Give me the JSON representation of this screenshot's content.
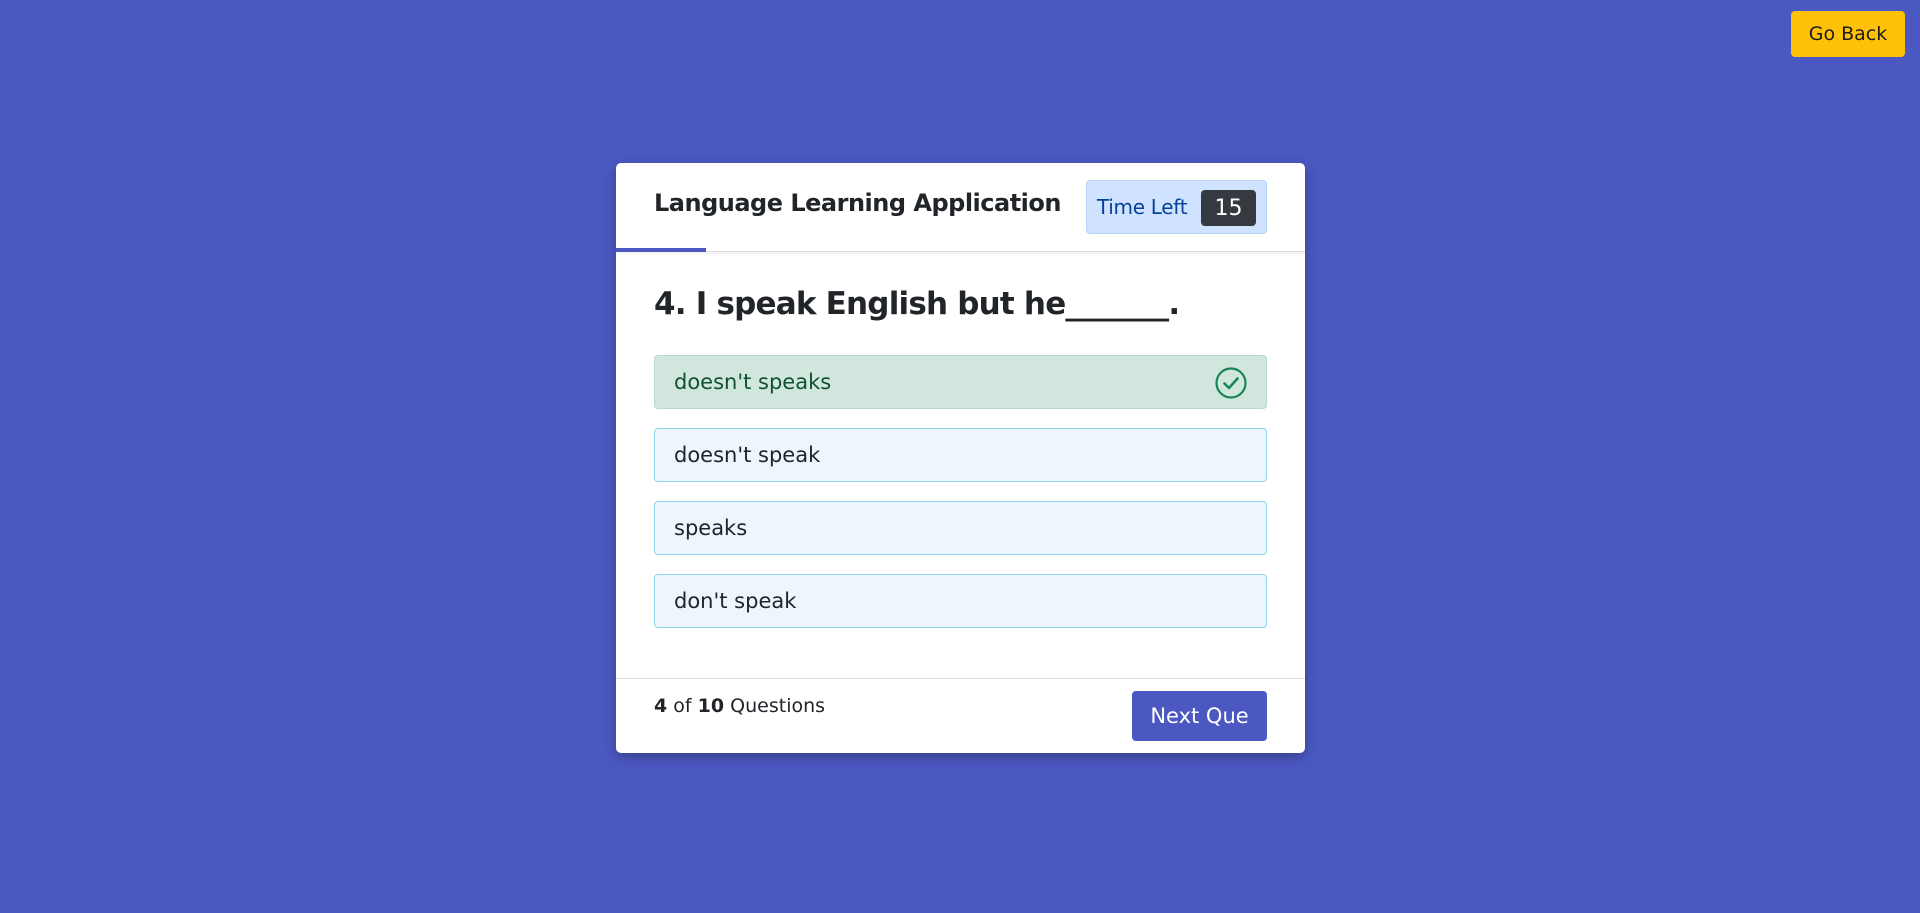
{
  "header": {
    "go_back_label": "Go Back"
  },
  "card": {
    "title": "Language Learning Application",
    "progress_fraction": 0.4,
    "timer": {
      "label": "Time Left",
      "value": "15"
    },
    "question": "4. I speak English but he_______.",
    "options": [
      {
        "label": "doesn't speaks",
        "state": "correct"
      },
      {
        "label": "doesn't speak",
        "state": "default"
      },
      {
        "label": "speaks",
        "state": "default"
      },
      {
        "label": "don't speak",
        "state": "default"
      }
    ],
    "footer": {
      "current": "4",
      "of_word": "of",
      "total": "10",
      "questions_word": "Questions",
      "next_label": "Next Que"
    }
  },
  "colors": {
    "background": "#4b58c2",
    "accent": "#4b58c2",
    "warning": "#ffc107",
    "correct_bg": "#d1e7dd",
    "correct_icon": "#198754",
    "option_bg": "#eef6fd",
    "option_border": "#8ed3ef"
  },
  "icons": {
    "correct": "check-circle-icon"
  }
}
